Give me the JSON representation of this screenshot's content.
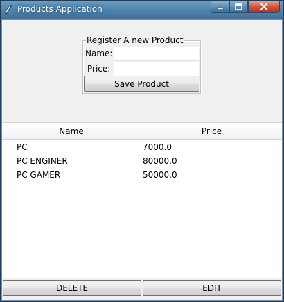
{
  "window": {
    "title": "Products Application",
    "icon": "feather-icon"
  },
  "form": {
    "group_title": "Register A new Product",
    "name_label": "Name:",
    "name_value": "",
    "price_label": "Price:",
    "price_value": "",
    "save_label": "Save Product"
  },
  "table": {
    "columns": [
      "Name",
      "Price"
    ],
    "rows": [
      {
        "name": "PC",
        "price": "7000.0"
      },
      {
        "name": "PC ENGINER",
        "price": "80000.0"
      },
      {
        "name": "PC GAMER",
        "price": "50000.0"
      }
    ]
  },
  "actions": {
    "delete_label": "DELETE",
    "edit_label": "EDIT"
  }
}
